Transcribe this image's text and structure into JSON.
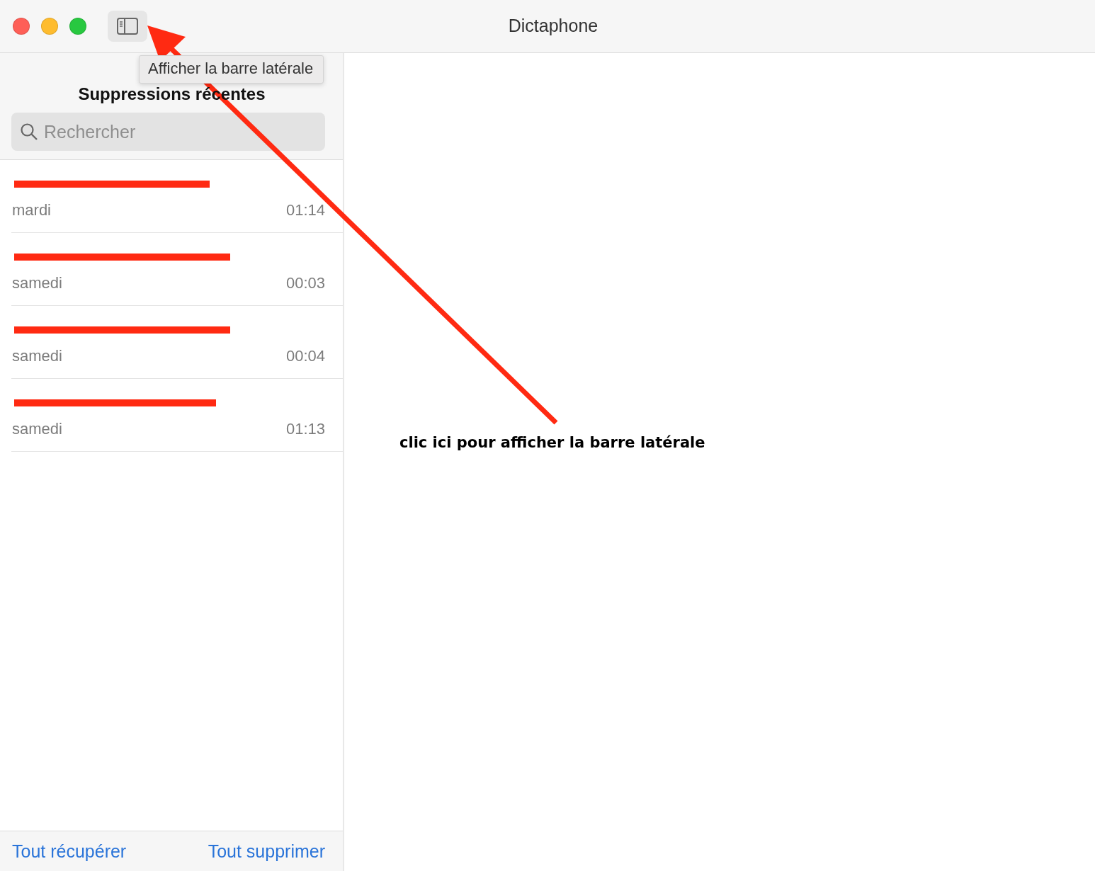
{
  "window": {
    "title": "Dictaphone"
  },
  "tooltip": {
    "text": "Afficher la barre latérale"
  },
  "sidebar": {
    "title": "Suppressions récentes",
    "search": {
      "placeholder": "Rechercher"
    },
    "recordings": [
      {
        "kind": "redacted",
        "day": "mardi",
        "duration": "01:14"
      },
      {
        "kind": "redacted",
        "day": "samedi",
        "duration": "00:03"
      },
      {
        "kind": "redacted",
        "day": "samedi",
        "duration": "00:04"
      },
      {
        "kind": "redacted",
        "day": "samedi",
        "duration": "01:13"
      }
    ],
    "footer": [
      "Tout récupérer",
      "Tout supprimer"
    ]
  },
  "annotation": {
    "text": "clic ici pour afficher la barre latérale"
  }
}
